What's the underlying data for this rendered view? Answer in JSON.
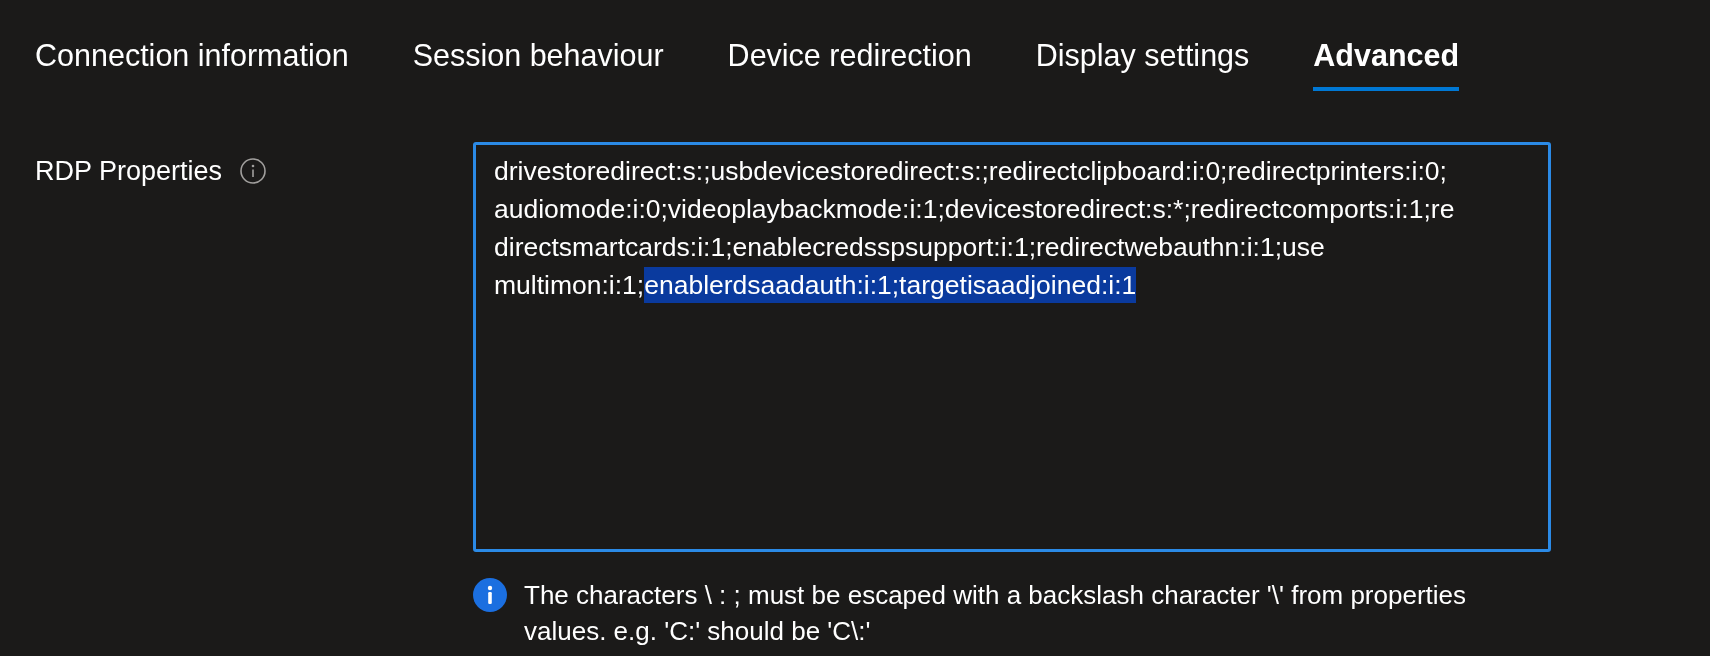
{
  "tabs": [
    {
      "label": "Connection information",
      "selected": false
    },
    {
      "label": "Session behaviour",
      "selected": false
    },
    {
      "label": "Device redirection",
      "selected": false
    },
    {
      "label": "Display settings",
      "selected": false
    },
    {
      "label": "Advanced",
      "selected": true
    }
  ],
  "rdp_properties": {
    "label": "RDP Properties",
    "focused": true,
    "lines": [
      [
        {
          "text": "drivestoredirect:s:;usbdevicestoredirect:s:;redirectclipboard:i:0;redirectprinters:i:0;",
          "selected": false
        }
      ],
      [
        {
          "text": "audiomode:i:0;videoplaybackmode:i:1;devicestoredirect:s:*;redirectcomports:i:1;re",
          "selected": false
        }
      ],
      [
        {
          "text": "directsmartcards:i:1;enablecredsspsupport:i:1;redirectwebauthn:i:1;use",
          "selected": false
        }
      ],
      [
        {
          "text": "multimon:i:1;",
          "selected": false
        },
        {
          "text": "enablerdsaadauth:i:1;targetisaadjoined:i:1",
          "selected": true
        }
      ]
    ],
    "note": "The characters \\ : ; must be escaped with a backslash character '\\' from properties values. e.g. 'C:' should be 'C\\:'"
  }
}
